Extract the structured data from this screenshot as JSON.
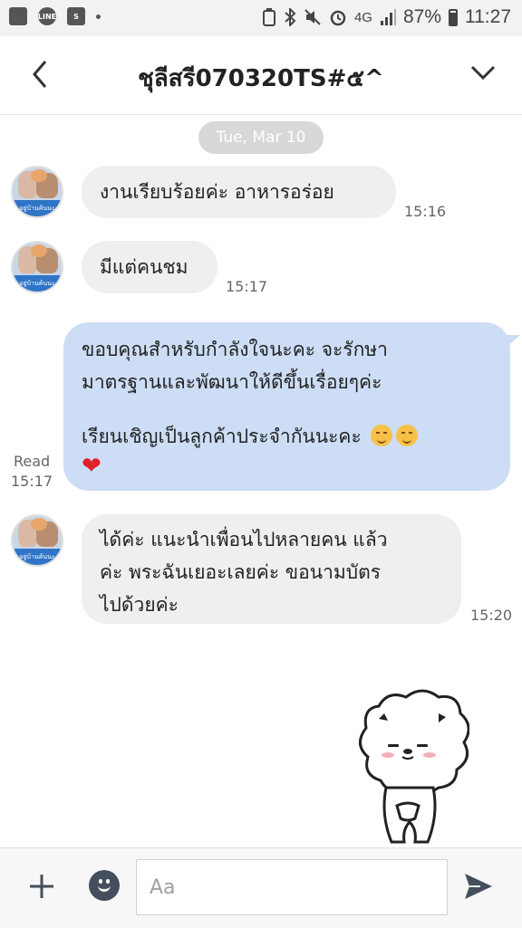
{
  "status_bar": {
    "network": "4G",
    "battery": "87%",
    "time": "11:27",
    "left_icons": [
      "gallery-icon",
      "line-app-icon",
      "shopee-icon",
      "notification-dot"
    ],
    "right_icons": [
      "battery-saver-icon",
      "bluetooth-icon",
      "mute-icon",
      "alarm-icon",
      "signal-icon",
      "battery-icon"
    ]
  },
  "header": {
    "title": "ชุลีสรี070320TS#๕^",
    "back_icon": "chevron-left-icon",
    "menu_icon": "chevron-down-icon"
  },
  "chat": {
    "date_chip": "Tue, Mar 10",
    "messages": [
      {
        "sender": "other",
        "text_lines": [
          "งานเรียบร้อยค่ะ  อาหารอร่อย"
        ],
        "time": "15:16"
      },
      {
        "sender": "other",
        "text_lines": [
          "มีแต่คนชม"
        ],
        "time": "15:17"
      },
      {
        "sender": "me",
        "text_lines": [
          "ขอบคุณสำหรับกำลังใจนะคะ จะรักษา",
          "มาตรฐานและพัฒนาให้ดีขึ้นเรื่อยๆค่ะ",
          "",
          "เรียนเชิญเป็นลูกค้าประจำกันนะคะ"
        ],
        "emoji": [
          "smiling-face-icon",
          "smiling-face-icon",
          "heart-icon"
        ],
        "heart": "❤",
        "read_label": "Read",
        "time": "15:17"
      },
      {
        "sender": "other",
        "text_lines": [
          "ได้ค่ะ  แนะนำเพื่อนไปหลายคน แล้ว",
          "ค่ะ  พระฉันเยอะเลยค่ะ  ขอนามบัตร",
          "ไปด้วยค่ะ"
        ],
        "time": "15:20"
      }
    ],
    "sticker": "bowing-bear-sticker"
  },
  "input_bar": {
    "placeholder": "Aa",
    "plus_icon": "plus-icon",
    "emoji_icon": "smile-icon",
    "send_icon": "send-icon"
  },
  "colors": {
    "my_bubble": "#cdddf5",
    "other_bubble": "#eeeff1",
    "date_chip": "#d6d8da",
    "heart": "#e0202c"
  }
}
